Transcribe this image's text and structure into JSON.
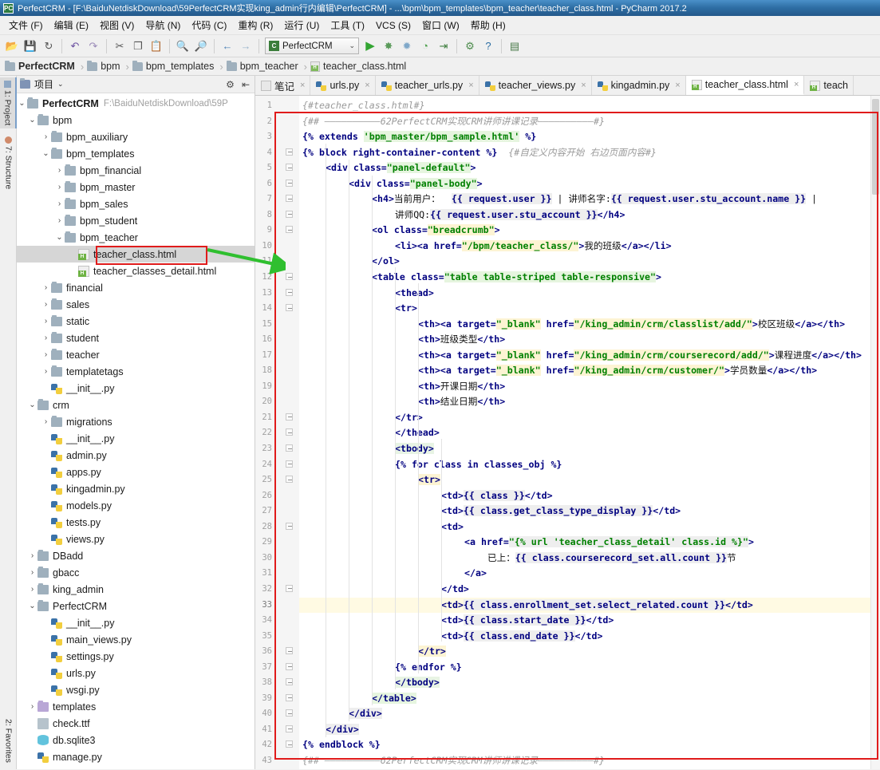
{
  "window": {
    "title": "PerfectCRM - [F:\\BaiduNetdiskDownload\\59PerfectCRM实现king_admin行内编辑\\PerfectCRM] - ...\\bpm\\bpm_templates\\bpm_teacher\\teacher_class.html - PyCharm 2017.2",
    "app_icon": "pycharm-icon"
  },
  "menubar": {
    "items": [
      {
        "label": "文件 (F)"
      },
      {
        "label": "编辑 (E)"
      },
      {
        "label": "视图 (V)"
      },
      {
        "label": "导航 (N)"
      },
      {
        "label": "代码 (C)"
      },
      {
        "label": "重构 (R)"
      },
      {
        "label": "运行 (U)"
      },
      {
        "label": "工具 (T)"
      },
      {
        "label": "VCS (S)"
      },
      {
        "label": "窗口 (W)"
      },
      {
        "label": "帮助 (H)"
      }
    ]
  },
  "toolbar": {
    "buttons": [
      {
        "name": "open-folder-icon",
        "glyph": "📂"
      },
      {
        "name": "save-all-icon",
        "glyph": "💾"
      },
      {
        "name": "sync-icon",
        "glyph": "↻"
      },
      {
        "name": "undo-icon",
        "glyph": "↶"
      },
      {
        "name": "redo-icon",
        "glyph": "↷"
      },
      {
        "name": "cut-icon",
        "glyph": "✂"
      },
      {
        "name": "copy-icon",
        "glyph": "❐"
      },
      {
        "name": "paste-icon",
        "glyph": "📋"
      },
      {
        "name": "find-icon",
        "glyph": "🔍"
      },
      {
        "name": "replace-icon",
        "glyph": "🔎"
      },
      {
        "name": "back-icon",
        "glyph": "←"
      },
      {
        "name": "forward-icon",
        "glyph": "→"
      }
    ],
    "run_config": {
      "label": "PerfectCRM",
      "caret": "⌄"
    },
    "run_buttons": [
      {
        "name": "run-icon",
        "glyph": "▶"
      },
      {
        "name": "debug-icon",
        "glyph": "✸"
      },
      {
        "name": "coverage-icon",
        "glyph": "✹"
      },
      {
        "name": "profile-icon",
        "glyph": "◔"
      },
      {
        "name": "attach-process-icon",
        "glyph": "⇥"
      },
      {
        "name": "settings-wrench-icon",
        "glyph": "⚙"
      },
      {
        "name": "help-icon",
        "glyph": "?"
      },
      {
        "name": "database-icon",
        "glyph": "▤"
      }
    ]
  },
  "breadcrumb": {
    "items": [
      {
        "label": "PerfectCRM",
        "icon": "folder-icon"
      },
      {
        "label": "bpm",
        "icon": "folder-icon"
      },
      {
        "label": "bpm_templates",
        "icon": "folder-icon"
      },
      {
        "label": "bpm_teacher",
        "icon": "folder-icon"
      },
      {
        "label": "teacher_class.html",
        "icon": "html-file-icon"
      }
    ],
    "separator": "›"
  },
  "left_strip": {
    "tabs": [
      {
        "label": "1: Project",
        "selected": true
      },
      {
        "label": "7: Structure",
        "selected": false
      }
    ],
    "bottom_tabs": [
      {
        "label": "2: Favorites"
      }
    ]
  },
  "project_panel": {
    "header": {
      "title": "项目",
      "caret": "⌄",
      "gear": "⚙",
      "collapse": "⇤"
    },
    "tree": [
      {
        "indent": 0,
        "arrow": "v",
        "icon": "folder",
        "label": "PerfectCRM",
        "bold": true,
        "path": "F:\\BaiduNetdiskDownload\\59P"
      },
      {
        "indent": 1,
        "arrow": "v",
        "icon": "folder",
        "label": "bpm"
      },
      {
        "indent": 2,
        "arrow": ">",
        "icon": "folder",
        "label": "bpm_auxiliary"
      },
      {
        "indent": 2,
        "arrow": "v",
        "icon": "folder",
        "label": "bpm_templates"
      },
      {
        "indent": 3,
        "arrow": ">",
        "icon": "folder",
        "label": "bpm_financial"
      },
      {
        "indent": 3,
        "arrow": ">",
        "icon": "folder",
        "label": "bpm_master"
      },
      {
        "indent": 3,
        "arrow": ">",
        "icon": "folder",
        "label": "bpm_sales"
      },
      {
        "indent": 3,
        "arrow": ">",
        "icon": "folder",
        "label": "bpm_student"
      },
      {
        "indent": 3,
        "arrow": "v",
        "icon": "folder",
        "label": "bpm_teacher"
      },
      {
        "indent": 4,
        "arrow": "",
        "icon": "html",
        "label": "teacher_class.html",
        "selected": true
      },
      {
        "indent": 4,
        "arrow": "",
        "icon": "html",
        "label": "teacher_classes_detail.html"
      },
      {
        "indent": 2,
        "arrow": ">",
        "icon": "folder",
        "label": "financial"
      },
      {
        "indent": 2,
        "arrow": ">",
        "icon": "folder",
        "label": "sales"
      },
      {
        "indent": 2,
        "arrow": ">",
        "icon": "folder",
        "label": "static"
      },
      {
        "indent": 2,
        "arrow": ">",
        "icon": "folder",
        "label": "student"
      },
      {
        "indent": 2,
        "arrow": ">",
        "icon": "folder",
        "label": "teacher"
      },
      {
        "indent": 2,
        "arrow": ">",
        "icon": "folder",
        "label": "templatetags"
      },
      {
        "indent": 2,
        "arrow": "",
        "icon": "py",
        "label": "__init__.py"
      },
      {
        "indent": 1,
        "arrow": "v",
        "icon": "folder",
        "label": "crm"
      },
      {
        "indent": 2,
        "arrow": ">",
        "icon": "folder",
        "label": "migrations"
      },
      {
        "indent": 2,
        "arrow": "",
        "icon": "py",
        "label": "__init__.py"
      },
      {
        "indent": 2,
        "arrow": "",
        "icon": "py",
        "label": "admin.py"
      },
      {
        "indent": 2,
        "arrow": "",
        "icon": "py",
        "label": "apps.py"
      },
      {
        "indent": 2,
        "arrow": "",
        "icon": "py",
        "label": "kingadmin.py"
      },
      {
        "indent": 2,
        "arrow": "",
        "icon": "py",
        "label": "models.py"
      },
      {
        "indent": 2,
        "arrow": "",
        "icon": "py",
        "label": "tests.py"
      },
      {
        "indent": 2,
        "arrow": "",
        "icon": "py",
        "label": "views.py"
      },
      {
        "indent": 1,
        "arrow": ">",
        "icon": "folder",
        "label": "DBadd"
      },
      {
        "indent": 1,
        "arrow": ">",
        "icon": "folder",
        "label": "gbacc"
      },
      {
        "indent": 1,
        "arrow": ">",
        "icon": "folder",
        "label": "king_admin"
      },
      {
        "indent": 1,
        "arrow": "v",
        "icon": "folder",
        "label": "PerfectCRM"
      },
      {
        "indent": 2,
        "arrow": "",
        "icon": "py",
        "label": "__init__.py"
      },
      {
        "indent": 2,
        "arrow": "",
        "icon": "py",
        "label": "main_views.py"
      },
      {
        "indent": 2,
        "arrow": "",
        "icon": "py",
        "label": "settings.py"
      },
      {
        "indent": 2,
        "arrow": "",
        "icon": "py",
        "label": "urls.py"
      },
      {
        "indent": 2,
        "arrow": "",
        "icon": "py",
        "label": "wsgi.py"
      },
      {
        "indent": 1,
        "arrow": ">",
        "icon": "folder-purple",
        "label": "templates"
      },
      {
        "indent": 1,
        "arrow": "",
        "icon": "ttf",
        "label": "check.ttf"
      },
      {
        "indent": 1,
        "arrow": "",
        "icon": "db",
        "label": "db.sqlite3"
      },
      {
        "indent": 1,
        "arrow": "",
        "icon": "py",
        "label": "manage.py"
      }
    ]
  },
  "editor_tabs": [
    {
      "label": "笔记",
      "icon": "note",
      "active": false,
      "close": "×"
    },
    {
      "label": "urls.py",
      "icon": "py",
      "active": false,
      "close": "×"
    },
    {
      "label": "teacher_urls.py",
      "icon": "py",
      "active": false,
      "close": "×"
    },
    {
      "label": "teacher_views.py",
      "icon": "py",
      "active": false,
      "close": "×"
    },
    {
      "label": "kingadmin.py",
      "icon": "py",
      "active": false,
      "close": "×"
    },
    {
      "label": "teacher_class.html",
      "icon": "html",
      "active": true,
      "close": "×"
    },
    {
      "label": "teach",
      "icon": "html",
      "active": false,
      "close": ""
    }
  ],
  "editor": {
    "current_line": 33,
    "line_count": 43,
    "lines": [
      {
        "n": 1,
        "indent": 0,
        "html": "<span class='c-com'>{#teacher_class.html#}</span>"
      },
      {
        "n": 2,
        "indent": 0,
        "html": "<span class='c-com'>{## ——————————62PerfectCRM实现CRM讲师讲课记录——————————#}</span>"
      },
      {
        "n": 3,
        "indent": 0,
        "html": "<span class='c-tmpl'>{% extends </span><span class='c-str hl-green'>'bpm_master/bpm_sample.html'</span><span class='c-tmpl'> %}</span>"
      },
      {
        "n": 4,
        "indent": 0,
        "fold": true,
        "html": "<span class='c-tmpl'>{% block right-container-content %}</span>  <span class='c-com'>{#自定义内容开始 右边页面内容#}</span>"
      },
      {
        "n": 5,
        "indent": 1,
        "fold": true,
        "html": "<span class='c-tag'>&lt;div </span><span class='c-attr'>class=</span><span class='c-str hl-green'>\"panel-default\"</span><span class='c-tag'>&gt;</span>"
      },
      {
        "n": 6,
        "indent": 2,
        "fold": true,
        "html": "<span class='c-tag'>&lt;div </span><span class='c-attr'>class=</span><span class='c-str hl-green'>\"panel-body\"</span><span class='c-tag'>&gt;</span>"
      },
      {
        "n": 7,
        "indent": 3,
        "fold": true,
        "html": "<span class='c-tag'>&lt;h4&gt;</span><span class='c-txt'>当前用户：</span>  <span class='c-var hl-gray'>{{ request.user }}</span><span class='c-txt'> | 讲师名字:</span><span class='c-var hl-gray'>{{ request.user.stu_account.name }}</span><span class='c-txt'> |</span>"
      },
      {
        "n": 8,
        "indent": 4,
        "fold": true,
        "html": "<span class='c-txt'>讲师QQ:</span><span class='c-var hl-gray'>{{ request.user.stu_account }}</span><span class='c-tag'>&lt;/h4&gt;</span>"
      },
      {
        "n": 9,
        "indent": 3,
        "fold": true,
        "html": "<span class='c-tag'>&lt;ol </span><span class='c-attr'>class=</span><span class='c-str hl-yellow'>\"breadcrumb\"</span><span class='c-tag'>&gt;</span>"
      },
      {
        "n": 10,
        "indent": 4,
        "html": "<span class='c-tag'>&lt;li&gt;&lt;a </span><span class='c-attr'>href=</span><span class='c-str hl-yellow'>\"/bpm/teacher_class/\"</span><span class='c-tag'>&gt;</span><span class='c-txt'>我的班级</span><span class='c-tag'>&lt;/a&gt;&lt;/li&gt;</span>"
      },
      {
        "n": 11,
        "indent": 3,
        "html": "<span class='c-tag'>&lt;/ol&gt;</span>"
      },
      {
        "n": 12,
        "indent": 3,
        "fold": true,
        "html": "<span class='c-tag'>&lt;table </span><span class='c-attr'>class=</span><span class='c-str hl-green'>\"table table-striped table-responsive\"</span><span class='c-tag'>&gt;</span>"
      },
      {
        "n": 13,
        "indent": 4,
        "fold": true,
        "html": "<span class='c-tag'>&lt;thead&gt;</span>"
      },
      {
        "n": 14,
        "indent": 4,
        "fold": true,
        "html": "<span class='c-tag'>&lt;tr&gt;</span>"
      },
      {
        "n": 15,
        "indent": 5,
        "html": "<span class='c-tag'>&lt;th&gt;&lt;a </span><span class='c-attr'>target=</span><span class='c-str hl-yellow'>\"_blank\"</span><span class='c-attr'> href=</span><span class='c-str hl-yellow'>\"/king_admin/crm/classlist/add/\"</span><span class='c-tag'>&gt;</span><span class='c-txt'>校区班级</span><span class='c-tag'>&lt;/a&gt;&lt;/th&gt;</span>"
      },
      {
        "n": 16,
        "indent": 5,
        "html": "<span class='c-tag'>&lt;th&gt;</span><span class='c-txt'>班级类型</span><span class='c-tag'>&lt;/th&gt;</span>"
      },
      {
        "n": 17,
        "indent": 5,
        "html": "<span class='c-tag'>&lt;th&gt;&lt;a </span><span class='c-attr'>target=</span><span class='c-str hl-yellow'>\"_blank\"</span><span class='c-attr'> href=</span><span class='c-str hl-yellow'>\"/king_admin/crm/courserecord/add/\"</span><span class='c-tag'>&gt;</span><span class='c-txt'>课程进度</span><span class='c-tag'>&lt;/a&gt;&lt;/th&gt;</span>"
      },
      {
        "n": 18,
        "indent": 5,
        "html": "<span class='c-tag'>&lt;th&gt;&lt;a </span><span class='c-attr'>target=</span><span class='c-str hl-yellow'>\"_blank\"</span><span class='c-attr'> href=</span><span class='c-str hl-yellow'>\"/king_admin/crm/customer/\"</span><span class='c-tag'>&gt;</span><span class='c-txt'>学员数量</span><span class='c-tag'>&lt;/a&gt;&lt;/th&gt;</span>"
      },
      {
        "n": 19,
        "indent": 5,
        "html": "<span class='c-tag'>&lt;th&gt;</span><span class='c-txt'>开课日期</span><span class='c-tag'>&lt;/th&gt;</span>"
      },
      {
        "n": 20,
        "indent": 5,
        "html": "<span class='c-tag'>&lt;th&gt;</span><span class='c-txt'>结业日期</span><span class='c-tag'>&lt;/th&gt;</span>"
      },
      {
        "n": 21,
        "indent": 4,
        "fold": true,
        "html": "<span class='c-tag'>&lt;/tr&gt;</span>"
      },
      {
        "n": 22,
        "indent": 4,
        "fold": true,
        "html": "<span class='c-tag'>&lt;/thead&gt;</span>"
      },
      {
        "n": 23,
        "indent": 4,
        "fold": true,
        "html": "<span class='c-tag hl-tagsel'>&lt;tbody&gt;</span>"
      },
      {
        "n": 24,
        "indent": 4,
        "fold": true,
        "html": "<span class='c-tmpl'>{% for class in classes_obj %}</span>"
      },
      {
        "n": 25,
        "indent": 5,
        "fold": true,
        "html": "<span class='c-tag hl-yellow'>&lt;tr&gt;</span>"
      },
      {
        "n": 26,
        "indent": 6,
        "html": "<span class='c-tag'>&lt;td&gt;</span><span class='c-var hl-gray'>{{ class }}</span><span class='c-tag'>&lt;/td&gt;</span>"
      },
      {
        "n": 27,
        "indent": 6,
        "html": "<span class='c-tag'>&lt;td&gt;</span><span class='c-var hl-gray'>{{ class.get_class_type_display }}</span><span class='c-tag'>&lt;/td&gt;</span>"
      },
      {
        "n": 28,
        "indent": 6,
        "fold": true,
        "html": "<span class='c-tag'>&lt;td&gt;</span>"
      },
      {
        "n": 29,
        "indent": 7,
        "html": "<span class='c-tag'>&lt;a </span><span class='c-attr'>href=</span><span class='c-str hl-gray'>\"{% url 'teacher_class_detail' class.id %}\"</span><span class='c-tag'>&gt;</span>"
      },
      {
        "n": 30,
        "indent": 8,
        "html": "<span class='c-txt'>已上：</span><span class='c-var hl-gray'>{{ class.courserecord_set.all.count }}</span><span class='c-txt'>节</span>"
      },
      {
        "n": 31,
        "indent": 7,
        "html": "<span class='c-tag'>&lt;/a&gt;</span>"
      },
      {
        "n": 32,
        "indent": 6,
        "fold": true,
        "html": "<span class='c-tag'>&lt;/td&gt;</span>"
      },
      {
        "n": 33,
        "indent": 6,
        "current": true,
        "html": "<span class='c-tag'>&lt;td&gt;</span><span class='c-var hl-gray'>{{ class.enrollment_set.select_related.count }}</span><span class='c-tag'>&lt;/td&gt;</span>"
      },
      {
        "n": 34,
        "indent": 6,
        "html": "<span class='c-tag'>&lt;td&gt;</span><span class='c-var hl-gray'>{{ class.start_date }}</span><span class='c-tag'>&lt;/td&gt;</span>"
      },
      {
        "n": 35,
        "indent": 6,
        "html": "<span class='c-tag'>&lt;td&gt;</span><span class='c-var hl-gray'>{{ class.end_date }}</span><span class='c-tag'>&lt;/td&gt;</span>"
      },
      {
        "n": 36,
        "indent": 5,
        "fold": true,
        "html": "<span class='c-tag hl-yellow'>&lt;/tr&gt;</span>"
      },
      {
        "n": 37,
        "indent": 4,
        "fold": true,
        "html": "<span class='c-tmpl'>{% endfor %}</span>"
      },
      {
        "n": 38,
        "indent": 4,
        "fold": true,
        "html": "<span class='c-tag hl-tagsel'>&lt;/tbody&gt;</span>"
      },
      {
        "n": 39,
        "indent": 3,
        "fold": true,
        "html": "<span class='c-tag hl-green'>&lt;/table&gt;</span>"
      },
      {
        "n": 40,
        "indent": 2,
        "fold": true,
        "html": "<span class='c-tag hl-gray'>&lt;/div&gt;</span>"
      },
      {
        "n": 41,
        "indent": 1,
        "fold": true,
        "html": "<span class='c-tag hl-gray'>&lt;/div&gt;</span>"
      },
      {
        "n": 42,
        "indent": 0,
        "fold": true,
        "html": "<span class='c-tmpl'>{% endblock %}</span>"
      },
      {
        "n": 43,
        "indent": 0,
        "html": "<span class='c-com'>{## ——————————62PerfectCRM实现CRM讲师讲课记录——————————#}</span>"
      }
    ]
  },
  "annotations": {
    "file_highlight_box": {
      "color": "#e01b1b"
    },
    "editor_highlight_box": {
      "color": "#e01b1b"
    },
    "arrow": {
      "color": "#2fbf2f"
    }
  }
}
